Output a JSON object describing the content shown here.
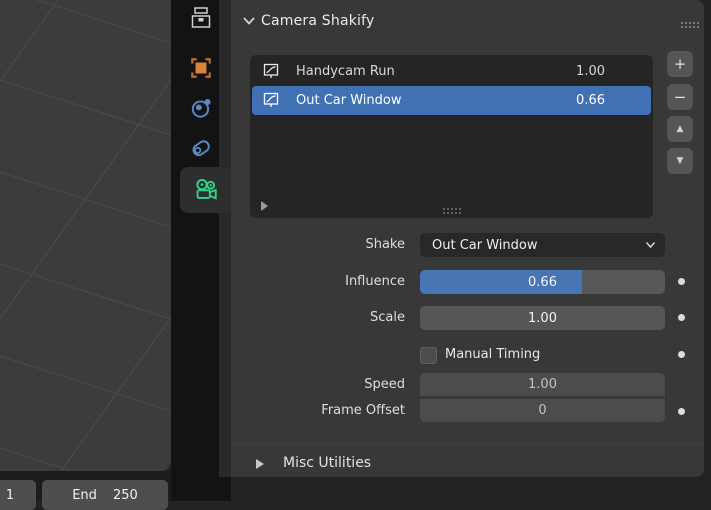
{
  "panel": {
    "title": "Camera Shakify",
    "header_grip_icon": "drag-grip",
    "shake_list": {
      "selected_index": 1,
      "rows": [
        {
          "icon": "fcurve-icon",
          "name": "Handycam Run",
          "value": "1.00"
        },
        {
          "icon": "fcurve-icon",
          "name": "Out Car Window",
          "value": "0.66"
        }
      ],
      "footer": {
        "expand_icon": "disclosure-triangle",
        "resize_grip_icon": "drag-grip"
      }
    },
    "list_buttons": [
      {
        "name": "add",
        "glyph": "+"
      },
      {
        "name": "remove",
        "glyph": "−"
      },
      {
        "name": "move-up",
        "glyph": "▲"
      },
      {
        "name": "move-down",
        "glyph": "▼"
      }
    ],
    "controls": {
      "shake": {
        "label": "Shake",
        "value": "Out Car Window",
        "type": "dropdown"
      },
      "influence": {
        "label": "Influence",
        "value": "0.66",
        "fraction": 0.66,
        "animatable_dot": true
      },
      "scale": {
        "label": "Scale",
        "value": "1.00",
        "animatable_dot": true
      },
      "manual_timing": {
        "label": "Manual Timing",
        "checked": false,
        "animatable_dot": true
      },
      "speed": {
        "label": "Speed",
        "value": "1.00",
        "disabled": true
      },
      "frame_offset": {
        "label": "Frame Offset",
        "value": "0",
        "disabled": true,
        "animatable_dot": true
      }
    },
    "subpanel": {
      "label": "Misc Utilities",
      "collapsed": true
    }
  },
  "tab_strip": {
    "tabs": [
      {
        "name": "render-properties"
      },
      {
        "name": "object-properties"
      },
      {
        "name": "physics-properties"
      },
      {
        "name": "constraint-properties"
      },
      {
        "name": "camera-data-properties",
        "active": true
      }
    ]
  },
  "timeline": {
    "current_frame": "1",
    "end_field": {
      "label": "End",
      "value": "250"
    }
  },
  "colors": {
    "accent_blue": "#4876b4",
    "selected_row_blue": "#4071b2",
    "tab_object_orange": "#d9833b",
    "tab_physics_blue": "#5c87c6",
    "tab_camera_green": "#2bd98a",
    "panel_bg": "#383838",
    "list_bg": "#252525",
    "field_bg": "#565656",
    "dropdown_bg": "#282828"
  }
}
